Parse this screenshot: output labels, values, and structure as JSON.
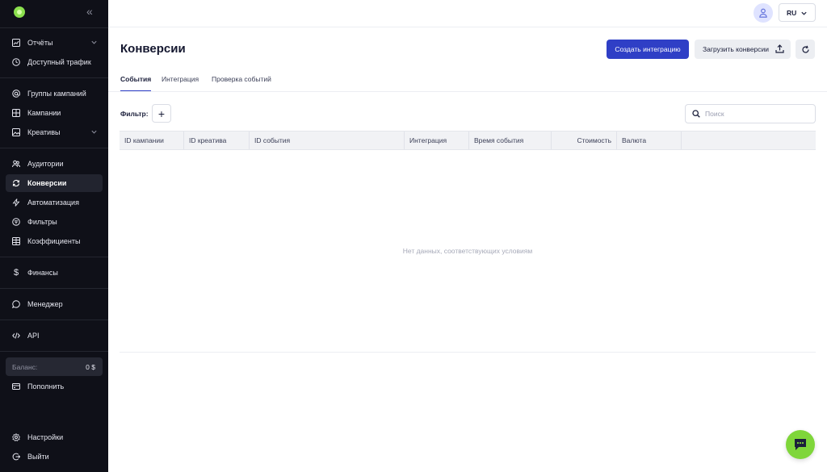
{
  "sidebar": {
    "items": [
      {
        "label": "Отчёты",
        "icon": "chart-icon"
      },
      {
        "label": "Доступный трафик",
        "icon": "clock-icon"
      },
      {
        "label": "Группы кампаний",
        "icon": "at-icon"
      },
      {
        "label": "Кампании",
        "icon": "grid-icon"
      },
      {
        "label": "Креативы",
        "icon": "image-icon"
      },
      {
        "label": "Аудитории",
        "icon": "users-icon"
      },
      {
        "label": "Конверсии",
        "icon": "refresh-icon"
      },
      {
        "label": "Автоматизация",
        "icon": "bolt-icon"
      },
      {
        "label": "Фильтры",
        "icon": "filter-icon"
      },
      {
        "label": "Коэффициенты",
        "icon": "table-icon"
      },
      {
        "label": "Финансы",
        "icon": "dollar-icon"
      },
      {
        "label": "Менеджер",
        "icon": "chat-icon"
      },
      {
        "label": "API",
        "icon": "code-icon"
      },
      {
        "label": "Пополнить",
        "icon": "wallet-icon"
      },
      {
        "label": "Настройки",
        "icon": "gear-icon"
      },
      {
        "label": "Выйти",
        "icon": "logout-icon"
      }
    ],
    "balance_label": "Баланс:",
    "balance_value": "0 $"
  },
  "header": {
    "lang": "RU"
  },
  "page": {
    "title": "Конверсии",
    "create_integration": "Создать интеграцию",
    "upload_conversions": "Загрузить конверсии"
  },
  "tabs": [
    "События",
    "Интеграция",
    "Проверка событий"
  ],
  "filter": {
    "label": "Фильтр:",
    "add": "+"
  },
  "search": {
    "placeholder": "Поиск",
    "value": ""
  },
  "table": {
    "columns": [
      "ID кампании",
      "ID креатива",
      "ID события",
      "Интеграция",
      "Время события",
      "Стоимость",
      "Валюта"
    ],
    "empty_text": "Нет данных, соответствующих условиям"
  },
  "colors": {
    "sidebar_bg": "#0f1018",
    "primary": "#2f3fc6",
    "accent_green": "#7fd63a"
  }
}
